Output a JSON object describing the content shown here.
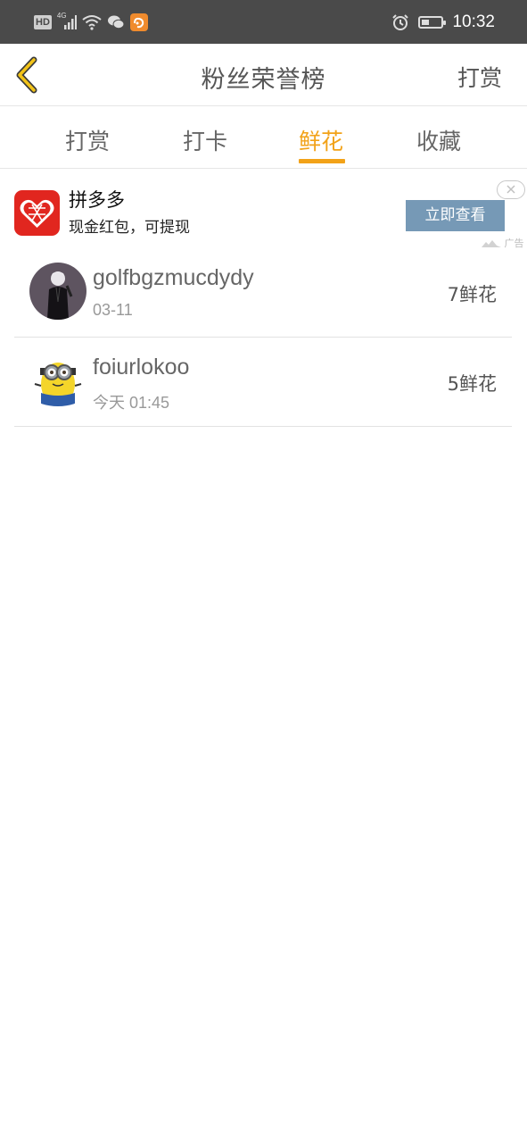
{
  "status_bar": {
    "left_badges": [
      "HD",
      "4G"
    ],
    "time": "10:32",
    "icons": [
      "hd-icon",
      "signal-icon",
      "wifi-icon",
      "wechat-icon",
      "uc-browser-icon",
      "alarm-icon",
      "battery-icon"
    ]
  },
  "header": {
    "title": "粉丝荣誉榜",
    "action": "打赏",
    "back_icon": "chevron-left-icon"
  },
  "tabs": {
    "items": [
      {
        "label": "打赏"
      },
      {
        "label": "打卡"
      },
      {
        "label": "鲜花"
      },
      {
        "label": "收藏"
      }
    ],
    "active_index": 2
  },
  "ad": {
    "title": "拼多多",
    "subtitle": "现金红包，可提现",
    "cta": "立即查看",
    "mark": "广告",
    "logo_icon": "pinduoduo-logo-icon",
    "close_icon": "close-icon"
  },
  "fans": [
    {
      "name": "golfbgzmucdydy",
      "date": "03-11",
      "count": "7鲜花"
    },
    {
      "name": "foiurlokoo",
      "date": "今天 01:45",
      "count": "5鲜花"
    }
  ],
  "colors": {
    "accent": "#f2a218",
    "status_bar": "#4a4a4a",
    "ad_button": "#7699b6",
    "ad_logo": "#e1261f"
  }
}
